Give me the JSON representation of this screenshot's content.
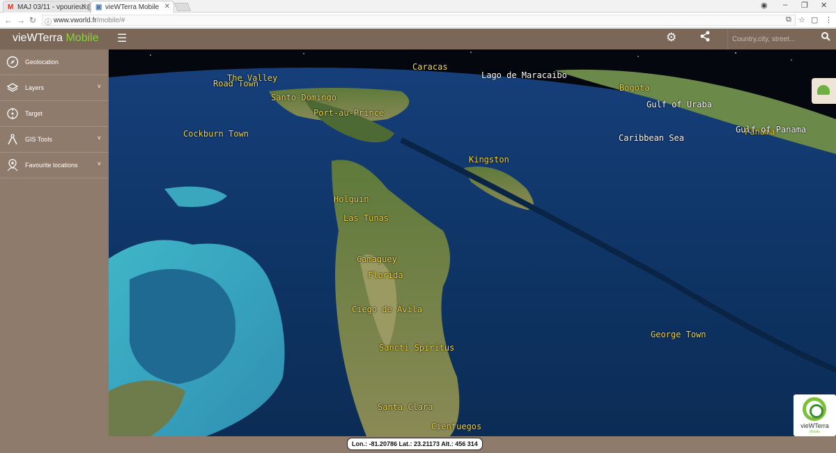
{
  "browser": {
    "tabs": [
      {
        "title": "MAJ 03/11 - vpourieux@"
      },
      {
        "title": "vieWTerra Mobile"
      }
    ],
    "url_main": "www.vworld.fr",
    "url_path": "/mobile/#"
  },
  "header": {
    "brand_main": "vieWTerra",
    "brand_accent": "Mobile",
    "search_placeholder": "Country,city, street..."
  },
  "sidebar": {
    "items": [
      {
        "label": "Geolocation",
        "icon": "compass-icon",
        "has_submenu": false
      },
      {
        "label": "Layers",
        "icon": "layers-icon",
        "has_submenu": true
      },
      {
        "label": "Target",
        "icon": "target-icon",
        "has_submenu": false
      },
      {
        "label": "GIS Tools",
        "icon": "compass-tool-icon",
        "has_submenu": true
      },
      {
        "label": "Favourite locations",
        "icon": "map-pin-icon",
        "has_submenu": true
      }
    ]
  },
  "map": {
    "labels_yellow": [
      "Caracas",
      "Bogota",
      "Santo Domingo",
      "Port-au-Prince",
      "Cockburn Town",
      "Kingston",
      "Holguin",
      "Las Tunas",
      "Camaguey",
      "Florida",
      "Ciego de Ávila",
      "Sancti Spíritus",
      "Santa Clara",
      "Cienfuegos",
      "George Town",
      "Panama",
      "Road Town",
      "The Valley"
    ],
    "labels_white": [
      "Lago de Maracaibo",
      "Gulf of Uraba",
      "Caribbean Sea",
      "Gulf of Panama"
    ],
    "logo_title": "vieWTerra",
    "logo_sub": "Mobile"
  },
  "status": {
    "coords": "Lon.: -81.20786  Lat.: 23.21173  Alt.: 456 314"
  },
  "colors": {
    "header_bg": "#7a6758",
    "sidebar_bg": "#8f7b6c",
    "accent_green": "#8bd13a",
    "label_yellow": "#f1d84a"
  }
}
